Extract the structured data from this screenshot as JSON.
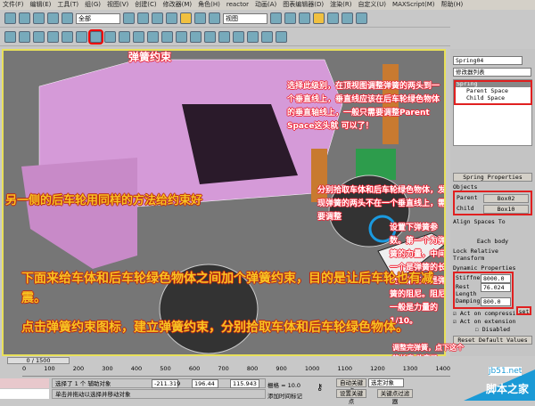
{
  "menu": [
    "文件(F)",
    "编辑(E)",
    "工具(T)",
    "组(G)",
    "视图(V)",
    "创建(C)",
    "修改器(M)",
    "角色(H)",
    "reactor",
    "动画(A)",
    "图表编辑器(D)",
    "渲染(R)",
    "自定义(U)",
    "MAXScript(M)",
    "帮助(H)"
  ],
  "toolbar1": {
    "selection_filter": "全部",
    "ref_coord": "视图"
  },
  "annotations": {
    "spring_constraint": "弹簧约束",
    "select_level": "选择此级别，在顶视图调整弹簧的两头到一个垂直线上，垂直线应该在后车轮绿色物体的垂直轴线上，一般只需要调整Parent Space这头就 可以了！",
    "pick_objects": "分别拾取车体和后车轮绿色物体，发现弹簧的两头不在一个垂直线上，需要调整",
    "other_side": "另一侧的后车轮用同样的方法给约束好",
    "set_params": "设置下弹簧参数。第一个为弹簧的力量，中间一个是弹簧的长度，第三个是弹簧的阻尼。阻尼一般是力量的1/10。",
    "main_1": "下面来给车体和后车轮绿色物体之间加个弹簧约束，目的是让后车轮也有减震。",
    "main_2": "点击弹簧约束图标，建立弹簧约束，分别拾取车体和后车轮绿色物体。",
    "after_adjust": "调整完弹簧，点下这个 的长度 改变了"
  },
  "panel": {
    "object_name": "Spring04",
    "modifier_list": "修改器列表",
    "stack": [
      "Spring",
      "Parent Space",
      "Child Space"
    ],
    "rollout": "Spring Properties",
    "objects_label": "Objects",
    "parent_label": "Parent",
    "parent_value": "Box02",
    "child_label": "Child",
    "child_value": "Box10",
    "align_label": "Align Spaces To",
    "each_body": "Each body",
    "lock_relative": "Lock Relative Transform",
    "dynamic_label": "Dynamic Properties",
    "stiffness_label": "Stiffness",
    "stiffness": "8000.0",
    "rest_length_label": "Rest Length",
    "rest_length": "76.024",
    "set_label": "set",
    "damping_label": "Damping",
    "damping": "800.0",
    "act_compression": "Act on compression",
    "act_extension": "Act on extension",
    "disabled": "Disabled",
    "reset": "Reset Default Values"
  },
  "timeline": {
    "frame": "0 / 1500",
    "ticks": [
      "0",
      "100",
      "200",
      "300",
      "400",
      "500",
      "600",
      "700",
      "800",
      "900",
      "1000",
      "1100",
      "1200",
      "1300",
      "1400"
    ]
  },
  "status": {
    "selected": "选择了 1 个 辅助对象",
    "prompt": "单击并拖动以选择并移动对象",
    "x": "-211.319",
    "y": "196.44",
    "z": "115.943",
    "grid": "栅格 = 10.0",
    "add_tag": "添加时间标记",
    "auto_key": "自动关键点",
    "set_key": "设置关键点",
    "key_mode": "选定对象",
    "key_filters": "关键点过滤器"
  },
  "watermark": {
    "site": "jb51.net",
    "name": "脚本之家"
  }
}
